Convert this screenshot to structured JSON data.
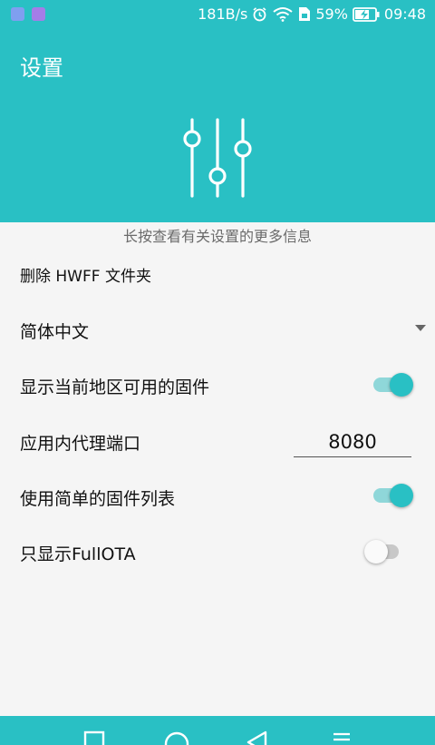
{
  "status_bar": {
    "net_speed": "181B/s",
    "battery_percent": "59%",
    "time": "09:48",
    "icons": [
      "app-icon-1",
      "app-icon-2",
      "alarm-icon",
      "wifi-icon",
      "sim-icon",
      "battery-charging-icon"
    ]
  },
  "header": {
    "title": "设置",
    "icon": "sliders-icon"
  },
  "settings": {
    "hint": "长按查看有关设置的更多信息",
    "delete_folder": {
      "label": "删除 HWFF 文件夹"
    },
    "language": {
      "label": "简体中文"
    },
    "show_region_firmware": {
      "label": "显示当前地区可用的固件",
      "checked": true
    },
    "proxy_port": {
      "label": "应用内代理端口",
      "value": "8080"
    },
    "simple_firmware_list": {
      "label": "使用简单的固件列表",
      "checked": true
    },
    "show_fullota_only": {
      "label": "只显示FullOTA",
      "checked": false
    }
  },
  "nav_bar": {
    "buttons": [
      "recents-icon",
      "home-icon",
      "back-icon",
      "menu-icon"
    ]
  },
  "colors": {
    "primary": "#29c0c4",
    "switch_track_on": "#8fd7d9",
    "switch_track_off": "#c8c8c8",
    "background": "#f5f5f5"
  }
}
